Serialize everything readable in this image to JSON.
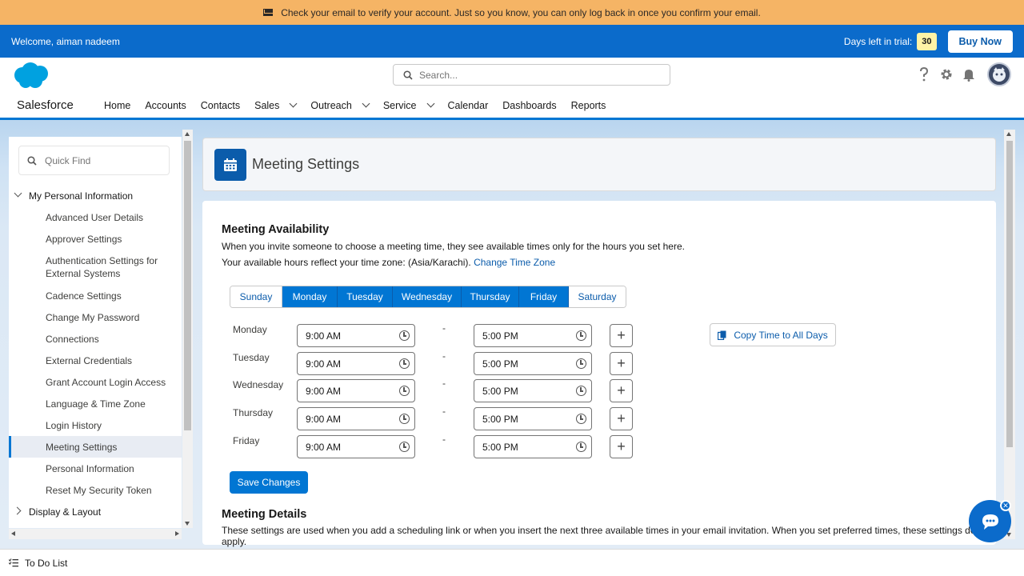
{
  "banner": {
    "message": "Check your email to verify your account. Just so you know, you can only log back in once you confirm your email.",
    "icon": "mail-icon"
  },
  "trial": {
    "welcome": "Welcome, aiman nadeem",
    "days_label": "Days left in trial:",
    "days_count": "30",
    "buy_label": "Buy Now"
  },
  "header": {
    "search_placeholder": "Search...",
    "icons": [
      "help-icon",
      "gear-icon",
      "bell-icon"
    ]
  },
  "appnav": {
    "app_name": "Salesforce",
    "items": [
      {
        "label": "Home",
        "dropdown": false
      },
      {
        "label": "Accounts",
        "dropdown": false
      },
      {
        "label": "Contacts",
        "dropdown": false
      },
      {
        "label": "Sales",
        "dropdown": true
      },
      {
        "label": "Outreach",
        "dropdown": true
      },
      {
        "label": "Service",
        "dropdown": true
      },
      {
        "label": "Calendar",
        "dropdown": false
      },
      {
        "label": "Dashboards",
        "dropdown": false
      },
      {
        "label": "Reports",
        "dropdown": false
      }
    ]
  },
  "sidebar": {
    "quickfind_placeholder": "Quick Find",
    "group": "My Personal Information",
    "items": [
      "Advanced User Details",
      "Approver Settings",
      "Authentication Settings for External Systems",
      "Cadence Settings",
      "Change My Password",
      "Connections",
      "External Credentials",
      "Grant Account Login Access",
      "Language & Time Zone",
      "Login History",
      "Meeting Settings",
      "Personal Information",
      "Reset My Security Token"
    ],
    "active_item": "Meeting Settings",
    "next_group": "Display & Layout"
  },
  "page": {
    "title": "Meeting Settings"
  },
  "availability": {
    "heading": "Meeting Availability",
    "desc1": "When you invite someone to choose a meeting time, they see available times only for the hours you set here.",
    "desc2": "Your available hours reflect your time zone: (Asia/Karachi).",
    "change_tz": "Change Time Zone",
    "days": [
      "Sunday",
      "Monday",
      "Tuesday",
      "Wednesday",
      "Thursday",
      "Friday",
      "Saturday"
    ],
    "selected_days": [
      "Monday",
      "Tuesday",
      "Wednesday",
      "Thursday",
      "Friday"
    ],
    "rows": [
      {
        "day": "Monday",
        "start": "9:00 AM",
        "end": "5:00 PM"
      },
      {
        "day": "Tuesday",
        "start": "9:00 AM",
        "end": "5:00 PM"
      },
      {
        "day": "Wednesday",
        "start": "9:00 AM",
        "end": "5:00 PM"
      },
      {
        "day": "Thursday",
        "start": "9:00 AM",
        "end": "5:00 PM"
      },
      {
        "day": "Friday",
        "start": "9:00 AM",
        "end": "5:00 PM"
      }
    ],
    "separator": "-",
    "copy_label": "Copy Time to All Days",
    "save_label": "Save Changes"
  },
  "details": {
    "heading": "Meeting Details",
    "desc": "These settings are used when you add a scheduling link or when you insert the next three available times in your email invitation. When you set preferred times, these settings don't apply."
  },
  "footer": {
    "todo_label": "To Do List"
  },
  "colors": {
    "brand": "#0176d3",
    "banner": "#f5b465",
    "trial_bar": "#0b6bcb"
  }
}
